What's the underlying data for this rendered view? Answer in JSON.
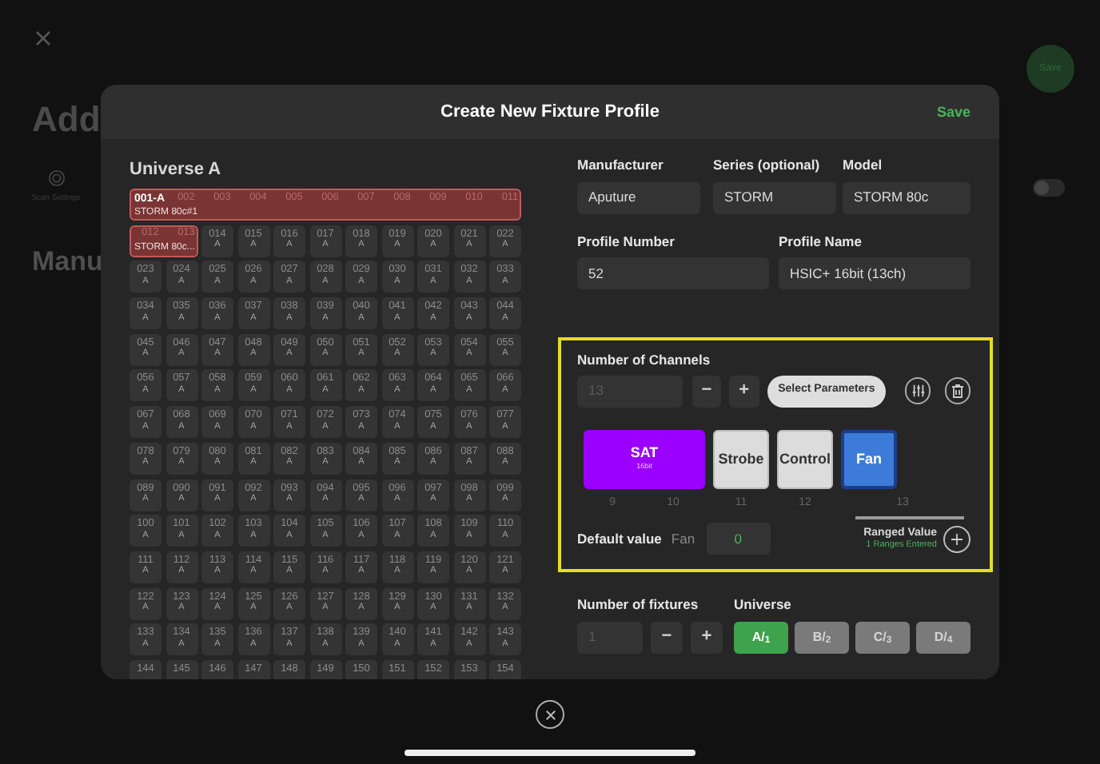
{
  "background_page": {
    "title": "Add",
    "section_title": "Manu",
    "scan_settings": {
      "label": "Scan Settings"
    },
    "save_button": {
      "label": "Save"
    },
    "toggle": {
      "on": false
    }
  },
  "modal": {
    "title": "Create New Fixture Profile",
    "save_label": "Save",
    "patch_grid": {
      "title": "Universe A",
      "rows": [
        {
          "cells": [
            {
              "kind": "fixture",
              "colspan": 11,
              "label": "001-A",
              "name": "STORM 80c#1",
              "channels": [
                "002",
                "003",
                "004",
                "005",
                "006",
                "007",
                "008",
                "009",
                "010",
                "011"
              ]
            }
          ]
        },
        {
          "cells": [
            {
              "kind": "fixture",
              "colspan": 2,
              "name": "STORM 80c...",
              "channels": [
                "012",
                "013"
              ]
            },
            {
              "kind": "channel",
              "number": "014",
              "universe": "A"
            },
            {
              "kind": "channel",
              "number": "015",
              "universe": "A"
            },
            {
              "kind": "channel",
              "number": "016",
              "universe": "A"
            },
            {
              "kind": "channel",
              "number": "017",
              "universe": "A"
            },
            {
              "kind": "channel",
              "number": "018",
              "universe": "A"
            },
            {
              "kind": "channel",
              "number": "019",
              "universe": "A"
            },
            {
              "kind": "channel",
              "number": "020",
              "universe": "A"
            },
            {
              "kind": "channel",
              "number": "021",
              "universe": "A"
            },
            {
              "kind": "channel",
              "number": "022",
              "universe": "A"
            }
          ]
        },
        {
          "cells": [
            {
              "kind": "channel",
              "number": "023",
              "universe": "A"
            },
            {
              "kind": "channel",
              "number": "024",
              "universe": "A"
            },
            {
              "kind": "channel",
              "number": "025",
              "universe": "A"
            },
            {
              "kind": "channel",
              "number": "026",
              "universe": "A"
            },
            {
              "kind": "channel",
              "number": "027",
              "universe": "A"
            },
            {
              "kind": "channel",
              "number": "028",
              "universe": "A"
            },
            {
              "kind": "channel",
              "number": "029",
              "universe": "A"
            },
            {
              "kind": "channel",
              "number": "030",
              "universe": "A"
            },
            {
              "kind": "channel",
              "number": "031",
              "universe": "A"
            },
            {
              "kind": "channel",
              "number": "032",
              "universe": "A"
            },
            {
              "kind": "channel",
              "number": "033",
              "universe": "A"
            }
          ]
        },
        {
          "cells": [
            {
              "kind": "channel",
              "number": "034",
              "universe": "A"
            },
            {
              "kind": "channel",
              "number": "035",
              "universe": "A"
            },
            {
              "kind": "channel",
              "number": "036",
              "universe": "A"
            },
            {
              "kind": "channel",
              "number": "037",
              "universe": "A"
            },
            {
              "kind": "channel",
              "number": "038",
              "universe": "A"
            },
            {
              "kind": "channel",
              "number": "039",
              "universe": "A"
            },
            {
              "kind": "channel",
              "number": "040",
              "universe": "A"
            },
            {
              "kind": "channel",
              "number": "041",
              "universe": "A"
            },
            {
              "kind": "channel",
              "number": "042",
              "universe": "A"
            },
            {
              "kind": "channel",
              "number": "043",
              "universe": "A"
            },
            {
              "kind": "channel",
              "number": "044",
              "universe": "A"
            }
          ]
        },
        {
          "cells": [
            {
              "kind": "channel",
              "number": "045",
              "universe": "A"
            },
            {
              "kind": "channel",
              "number": "046",
              "universe": "A"
            },
            {
              "kind": "channel",
              "number": "047",
              "universe": "A"
            },
            {
              "kind": "channel",
              "number": "048",
              "universe": "A"
            },
            {
              "kind": "channel",
              "number": "049",
              "universe": "A"
            },
            {
              "kind": "channel",
              "number": "050",
              "universe": "A"
            },
            {
              "kind": "channel",
              "number": "051",
              "universe": "A"
            },
            {
              "kind": "channel",
              "number": "052",
              "universe": "A"
            },
            {
              "kind": "channel",
              "number": "053",
              "universe": "A"
            },
            {
              "kind": "channel",
              "number": "054",
              "universe": "A"
            },
            {
              "kind": "channel",
              "number": "055",
              "universe": "A"
            }
          ]
        },
        {
          "cells": [
            {
              "kind": "channel",
              "number": "056",
              "universe": "A"
            },
            {
              "kind": "channel",
              "number": "057",
              "universe": "A"
            },
            {
              "kind": "channel",
              "number": "058",
              "universe": "A"
            },
            {
              "kind": "channel",
              "number": "059",
              "universe": "A"
            },
            {
              "kind": "channel",
              "number": "060",
              "universe": "A"
            },
            {
              "kind": "channel",
              "number": "061",
              "universe": "A"
            },
            {
              "kind": "channel",
              "number": "062",
              "universe": "A"
            },
            {
              "kind": "channel",
              "number": "063",
              "universe": "A"
            },
            {
              "kind": "channel",
              "number": "064",
              "universe": "A"
            },
            {
              "kind": "channel",
              "number": "065",
              "universe": "A"
            },
            {
              "kind": "channel",
              "number": "066",
              "universe": "A"
            }
          ]
        },
        {
          "cells": [
            {
              "kind": "channel",
              "number": "067",
              "universe": "A"
            },
            {
              "kind": "channel",
              "number": "068",
              "universe": "A"
            },
            {
              "kind": "channel",
              "number": "069",
              "universe": "A"
            },
            {
              "kind": "channel",
              "number": "070",
              "universe": "A"
            },
            {
              "kind": "channel",
              "number": "071",
              "universe": "A"
            },
            {
              "kind": "channel",
              "number": "072",
              "universe": "A"
            },
            {
              "kind": "channel",
              "number": "073",
              "universe": "A"
            },
            {
              "kind": "channel",
              "number": "074",
              "universe": "A"
            },
            {
              "kind": "channel",
              "number": "075",
              "universe": "A"
            },
            {
              "kind": "channel",
              "number": "076",
              "universe": "A"
            },
            {
              "kind": "channel",
              "number": "077",
              "universe": "A"
            }
          ]
        },
        {
          "cells": [
            {
              "kind": "channel",
              "number": "078",
              "universe": "A"
            },
            {
              "kind": "channel",
              "number": "079",
              "universe": "A"
            },
            {
              "kind": "channel",
              "number": "080",
              "universe": "A"
            },
            {
              "kind": "channel",
              "number": "081",
              "universe": "A"
            },
            {
              "kind": "channel",
              "number": "082",
              "universe": "A"
            },
            {
              "kind": "channel",
              "number": "083",
              "universe": "A"
            },
            {
              "kind": "channel",
              "number": "084",
              "universe": "A"
            },
            {
              "kind": "channel",
              "number": "085",
              "universe": "A"
            },
            {
              "kind": "channel",
              "number": "086",
              "universe": "A"
            },
            {
              "kind": "channel",
              "number": "087",
              "universe": "A"
            },
            {
              "kind": "channel",
              "number": "088",
              "universe": "A"
            }
          ]
        },
        {
          "cells": [
            {
              "kind": "channel",
              "number": "089",
              "universe": "A"
            },
            {
              "kind": "channel",
              "number": "090",
              "universe": "A"
            },
            {
              "kind": "channel",
              "number": "091",
              "universe": "A"
            },
            {
              "kind": "channel",
              "number": "092",
              "universe": "A"
            },
            {
              "kind": "channel",
              "number": "093",
              "universe": "A"
            },
            {
              "kind": "channel",
              "number": "094",
              "universe": "A"
            },
            {
              "kind": "channel",
              "number": "095",
              "universe": "A"
            },
            {
              "kind": "channel",
              "number": "096",
              "universe": "A"
            },
            {
              "kind": "channel",
              "number": "097",
              "universe": "A"
            },
            {
              "kind": "channel",
              "number": "098",
              "universe": "A"
            },
            {
              "kind": "channel",
              "number": "099",
              "universe": "A"
            }
          ]
        },
        {
          "cells": [
            {
              "kind": "channel",
              "number": "100",
              "universe": "A"
            },
            {
              "kind": "channel",
              "number": "101",
              "universe": "A"
            },
            {
              "kind": "channel",
              "number": "102",
              "universe": "A"
            },
            {
              "kind": "channel",
              "number": "103",
              "universe": "A"
            },
            {
              "kind": "channel",
              "number": "104",
              "universe": "A"
            },
            {
              "kind": "channel",
              "number": "105",
              "universe": "A"
            },
            {
              "kind": "channel",
              "number": "106",
              "universe": "A"
            },
            {
              "kind": "channel",
              "number": "107",
              "universe": "A"
            },
            {
              "kind": "channel",
              "number": "108",
              "universe": "A"
            },
            {
              "kind": "channel",
              "number": "109",
              "universe": "A"
            },
            {
              "kind": "channel",
              "number": "110",
              "universe": "A"
            }
          ]
        },
        {
          "cells": [
            {
              "kind": "channel",
              "number": "111",
              "universe": "A"
            },
            {
              "kind": "channel",
              "number": "112",
              "universe": "A"
            },
            {
              "kind": "channel",
              "number": "113",
              "universe": "A"
            },
            {
              "kind": "channel",
              "number": "114",
              "universe": "A"
            },
            {
              "kind": "channel",
              "number": "115",
              "universe": "A"
            },
            {
              "kind": "channel",
              "number": "116",
              "universe": "A"
            },
            {
              "kind": "channel",
              "number": "117",
              "universe": "A"
            },
            {
              "kind": "channel",
              "number": "118",
              "universe": "A"
            },
            {
              "kind": "channel",
              "number": "119",
              "universe": "A"
            },
            {
              "kind": "channel",
              "number": "120",
              "universe": "A"
            },
            {
              "kind": "channel",
              "number": "121",
              "universe": "A"
            }
          ]
        },
        {
          "cells": [
            {
              "kind": "channel",
              "number": "122",
              "universe": "A"
            },
            {
              "kind": "channel",
              "number": "123",
              "universe": "A"
            },
            {
              "kind": "channel",
              "number": "124",
              "universe": "A"
            },
            {
              "kind": "channel",
              "number": "125",
              "universe": "A"
            },
            {
              "kind": "channel",
              "number": "126",
              "universe": "A"
            },
            {
              "kind": "channel",
              "number": "127",
              "universe": "A"
            },
            {
              "kind": "channel",
              "number": "128",
              "universe": "A"
            },
            {
              "kind": "channel",
              "number": "129",
              "universe": "A"
            },
            {
              "kind": "channel",
              "number": "130",
              "universe": "A"
            },
            {
              "kind": "channel",
              "number": "131",
              "universe": "A"
            },
            {
              "kind": "channel",
              "number": "132",
              "universe": "A"
            }
          ]
        },
        {
          "cells": [
            {
              "kind": "channel",
              "number": "133",
              "universe": "A"
            },
            {
              "kind": "channel",
              "number": "134",
              "universe": "A"
            },
            {
              "kind": "channel",
              "number": "135",
              "universe": "A"
            },
            {
              "kind": "channel",
              "number": "136",
              "universe": "A"
            },
            {
              "kind": "channel",
              "number": "137",
              "universe": "A"
            },
            {
              "kind": "channel",
              "number": "138",
              "universe": "A"
            },
            {
              "kind": "channel",
              "number": "139",
              "universe": "A"
            },
            {
              "kind": "channel",
              "number": "140",
              "universe": "A"
            },
            {
              "kind": "channel",
              "number": "141",
              "universe": "A"
            },
            {
              "kind": "channel",
              "number": "142",
              "universe": "A"
            },
            {
              "kind": "channel",
              "number": "143",
              "universe": "A"
            }
          ]
        },
        {
          "cells": [
            {
              "kind": "channel",
              "number": "144"
            },
            {
              "kind": "channel",
              "number": "145"
            },
            {
              "kind": "channel",
              "number": "146"
            },
            {
              "kind": "channel",
              "number": "147"
            },
            {
              "kind": "channel",
              "number": "148"
            },
            {
              "kind": "channel",
              "number": "149"
            },
            {
              "kind": "channel",
              "number": "150"
            },
            {
              "kind": "channel",
              "number": "151"
            },
            {
              "kind": "channel",
              "number": "152"
            },
            {
              "kind": "channel",
              "number": "153"
            },
            {
              "kind": "channel",
              "number": "154"
            }
          ]
        }
      ]
    },
    "form": {
      "manufacturer": {
        "label": "Manufacturer",
        "value": "Aputure"
      },
      "series": {
        "label": "Series (optional)",
        "value": "STORM"
      },
      "model": {
        "label": "Model",
        "value": "STORM 80c"
      },
      "profile_number": {
        "label": "Profile Number",
        "value": "52"
      },
      "profile_name": {
        "label": "Profile Name",
        "value": "HSIC+ 16bit (13ch)"
      },
      "channels_panel": {
        "label": "Number of Channels",
        "count": {
          "value": "13",
          "disabled": true
        },
        "minus": "−",
        "plus": "+",
        "select_button": "Select Parameters",
        "parameters": [
          {
            "name": "SAT",
            "detail": "16bit",
            "color": "#9b00ff",
            "selected": false,
            "channels": [
              "9",
              "10"
            ]
          },
          {
            "name": "Strobe",
            "color": "#dcdcdc",
            "selected": false,
            "channels": [
              "11"
            ]
          },
          {
            "name": "Control",
            "color": "#dcdcdc",
            "selected": false,
            "channels": [
              "12"
            ]
          },
          {
            "name": "Fan",
            "color": "#3d7bd8",
            "selected": true,
            "channels": [
              "13"
            ]
          }
        ],
        "default_value": {
          "label": "Default value",
          "parameter": "Fan",
          "value": "0"
        },
        "ranged_value": {
          "label": "Ranged Value",
          "status": "1 Ranges Entered"
        }
      },
      "fixtures": {
        "label": "Number of fixtures",
        "value": "1",
        "minus": "−",
        "plus": "+"
      },
      "universe": {
        "label": "Universe",
        "options": [
          {
            "label": "A/$_{1}$",
            "selected": true
          },
          {
            "label": "B/$_{2}$",
            "selected": false
          },
          {
            "label": "C/$_{3}$",
            "selected": false
          },
          {
            "label": "D/$_{4}$",
            "selected": false
          }
        ]
      }
    }
  }
}
